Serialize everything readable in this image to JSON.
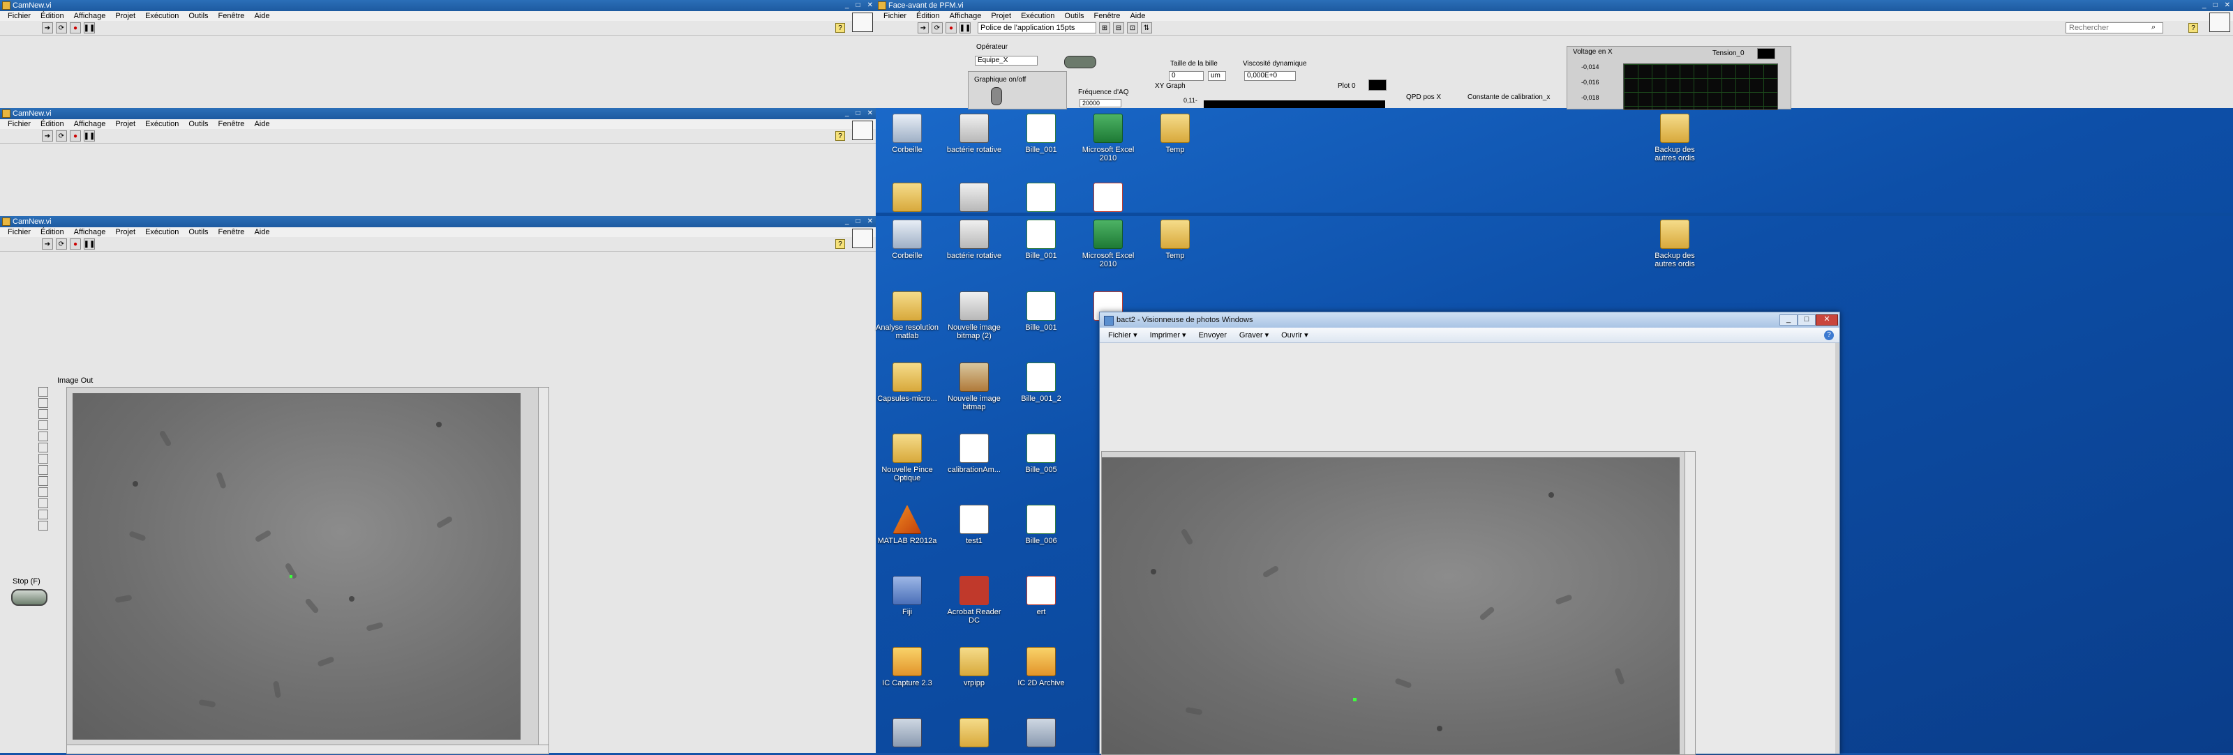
{
  "labview_windows": [
    {
      "title": "CamNew.vi"
    },
    {
      "title": "CamNew.vi"
    },
    {
      "title": "CamNew.vi"
    }
  ],
  "window_controls": {
    "min": "_",
    "max": "□",
    "close": "✕"
  },
  "lv_menu": [
    "Fichier",
    "Édition",
    "Affichage",
    "Projet",
    "Exécution",
    "Outils",
    "Fenêtre",
    "Aide"
  ],
  "lv_toolbar_icons": [
    "run-arrow-icon",
    "run-continuous-icon",
    "abort-icon",
    "pause-icon"
  ],
  "help_label": "?",
  "image_out": {
    "label": "Image Out"
  },
  "stop_control": {
    "label": "Stop (F)"
  },
  "pfm_window": {
    "title": "Face-avant de PFM.vi",
    "font_select": "Police de l'application 15pts",
    "search_placeholder": "Rechercher",
    "operator_label": "Opérateur",
    "operator_value": "Equipe_X",
    "graph_toggle_label": "Graphique on/off",
    "freq_label": "Fréquence d'AQ",
    "freq_value": "20000",
    "bead_size_label": "Taille de la bille",
    "bead_size_value": "0",
    "bead_unit": "um",
    "viscosity_label": "Viscosité dynamique",
    "viscosity_value": "0,000E+0",
    "xy_graph_label": "XY Graph",
    "plot_label": "Plot 0",
    "xy_tick": "0,11-",
    "qpd_label": "QPD pos X",
    "calib_label": "Constante de calibration_x",
    "voltage_label": "Voltage en X",
    "voltage_ticks": [
      "-0,014",
      "-0,016",
      "-0,018"
    ],
    "tension_label": "Tension_0"
  },
  "desktop_icons": [
    {
      "label": "Corbeille",
      "kind": "bin"
    },
    {
      "label": "bactérie rotative",
      "kind": "shot"
    },
    {
      "label": "Bille_001",
      "kind": "xls"
    },
    {
      "label": "Microsoft Excel 2010",
      "kind": "excel"
    },
    {
      "label": "Temp",
      "kind": "folder"
    },
    {
      "label": "Backup des autres ordis",
      "kind": "folder"
    },
    {
      "label": "Analyse resolution matlab",
      "kind": "folder"
    },
    {
      "label": "Nouvelle image bitmap (2)",
      "kind": "shot"
    },
    {
      "label": "Bille_001",
      "kind": "xls"
    },
    {
      "label": "Capsules-micro...",
      "kind": "folder"
    },
    {
      "label": "Nouvelle image bitmap",
      "kind": "img"
    },
    {
      "label": "Bille_001_2",
      "kind": "xls"
    },
    {
      "label": "Nouvelle Pince Optique",
      "kind": "folder"
    },
    {
      "label": "calibrationAm...",
      "kind": "doc"
    },
    {
      "label": "Bille_005",
      "kind": "xls"
    },
    {
      "label": "MATLAB R2012a",
      "kind": "matlab"
    },
    {
      "label": "test1",
      "kind": "doc"
    },
    {
      "label": "Bille_006",
      "kind": "xls"
    },
    {
      "label": "Fiji",
      "kind": "fiji"
    },
    {
      "label": "Acrobat Reader DC",
      "kind": "pdf"
    },
    {
      "label": "ert",
      "kind": "pdf"
    },
    {
      "label": "IC Capture 2.3",
      "kind": "ic"
    },
    {
      "label": "vrpipp",
      "kind": "folder"
    },
    {
      "label": "IC 2D Archive",
      "kind": "ic"
    }
  ],
  "photo_viewer": {
    "title": "bact2 - Visionneuse de photos Windows",
    "menu": [
      "Fichier",
      "Imprimer",
      "Envoyer",
      "Graver",
      "Ouvrir"
    ],
    "help": "?"
  }
}
